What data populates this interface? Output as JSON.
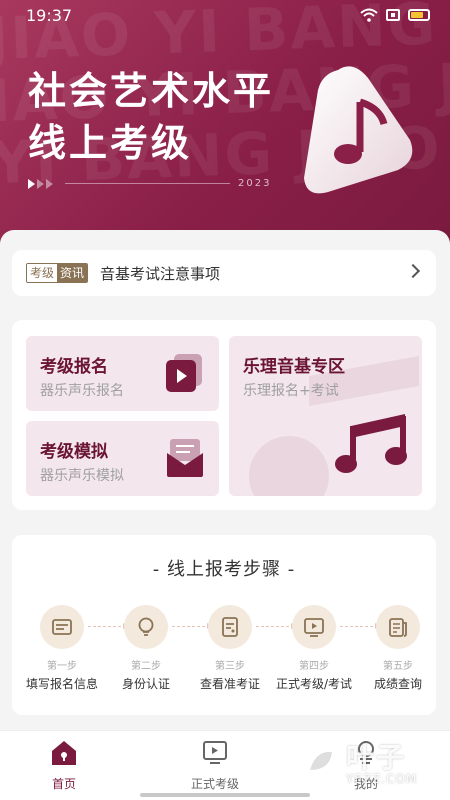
{
  "status_bar": {
    "time": "19:37"
  },
  "banner": {
    "bg_letters": [
      "JIAO YI BANG",
      "IAO YI BANG JIAO Y",
      "YI BANG JIAO YI BAN"
    ],
    "title_line1": "社会艺术水平",
    "title_line2": "线上考级",
    "year": "2023"
  },
  "news": {
    "tag_left": "考级",
    "tag_right": "资讯",
    "text": "音基考试注意事项"
  },
  "tiles": [
    {
      "title": "考级报名",
      "subtitle": "器乐声乐报名",
      "icon": "play-card-icon"
    },
    {
      "title": "考级模拟",
      "subtitle": "器乐声乐模拟",
      "icon": "mail-icon"
    },
    {
      "title": "乐理音基专区",
      "subtitle": "乐理报名+考试",
      "icon": "music-note-icon"
    }
  ],
  "steps": {
    "title": "- 线上报考步骤 -",
    "items": [
      {
        "no": "第一步",
        "label": "填写报名信息",
        "icon": "form-icon"
      },
      {
        "no": "第二步",
        "label": "身份认证",
        "icon": "bulb-icon"
      },
      {
        "no": "第三步",
        "label": "查看准考证",
        "icon": "ticket-icon"
      },
      {
        "no": "第四步",
        "label": "正式考级/考试",
        "icon": "video-icon"
      },
      {
        "no": "第五步",
        "label": "成绩查询",
        "icon": "score-icon"
      }
    ]
  },
  "tabbar": {
    "items": [
      {
        "label": "首页",
        "active": true,
        "icon": "home-icon"
      },
      {
        "label": "正式考级",
        "active": false,
        "icon": "exam-icon"
      },
      {
        "label": "我的",
        "active": false,
        "icon": "profile-icon"
      }
    ]
  },
  "watermark": {
    "text": "叶子",
    "url": "YEZZ.COM"
  },
  "colors": {
    "brand": "#7a1a3e",
    "tile_bg": "#f3e6ec",
    "step_bg": "#f3e9dd"
  }
}
